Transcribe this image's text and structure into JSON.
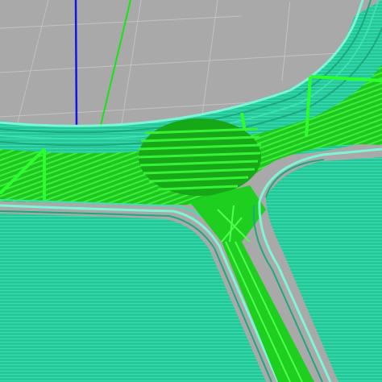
{
  "viewport": {
    "colors": {
      "background": "#a9a9a9",
      "grid": "#bfbfbf",
      "axis_z": "#1414e6",
      "axis_y": "#14e614",
      "perimeter": "#2cd4a0",
      "perimeter_edge": "#7ff5d8",
      "infill": "#22dd22",
      "infill_dark": "#0f9a0f",
      "support": "#33ff33"
    },
    "icons": {
      "z_axis": "z-axis-line",
      "y_axis": "y-axis-line"
    }
  }
}
